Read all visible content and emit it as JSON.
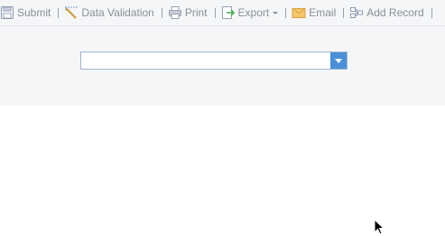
{
  "toolbar": {
    "submit_label": "Submit",
    "data_validation_label": "Data Validation",
    "print_label": "Print",
    "export_label": "Export",
    "email_label": "Email",
    "add_record_label": "Add Record"
  },
  "form": {
    "combo_value": ""
  }
}
